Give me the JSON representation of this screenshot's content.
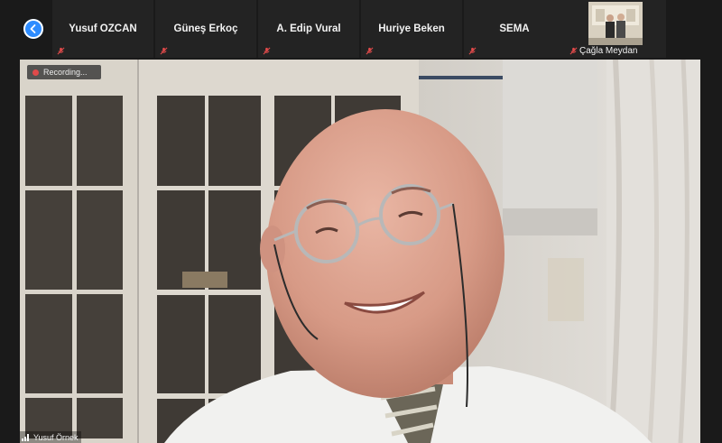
{
  "participants": [
    {
      "name": "Yusuf OZCAN",
      "muted": true
    },
    {
      "name": "Güneş Erkoç",
      "muted": true
    },
    {
      "name": "A. Edip Vural",
      "muted": true
    },
    {
      "name": "Huriye Beken",
      "muted": true
    },
    {
      "name": "SEMA",
      "muted": true
    },
    {
      "name": "Çağla Meydan",
      "muted": true,
      "has_video": true
    }
  ],
  "recording": {
    "label": "Recording..."
  },
  "active_speaker": {
    "name": "Yusuf Örnek"
  },
  "colors": {
    "accent": "#2d8cff",
    "muted_mic": "#e04a4a",
    "background": "#1a1a1a"
  },
  "icons": {
    "back": "chevron-left-icon",
    "mic": "mic-muted-icon",
    "signal": "signal-bars-icon"
  }
}
